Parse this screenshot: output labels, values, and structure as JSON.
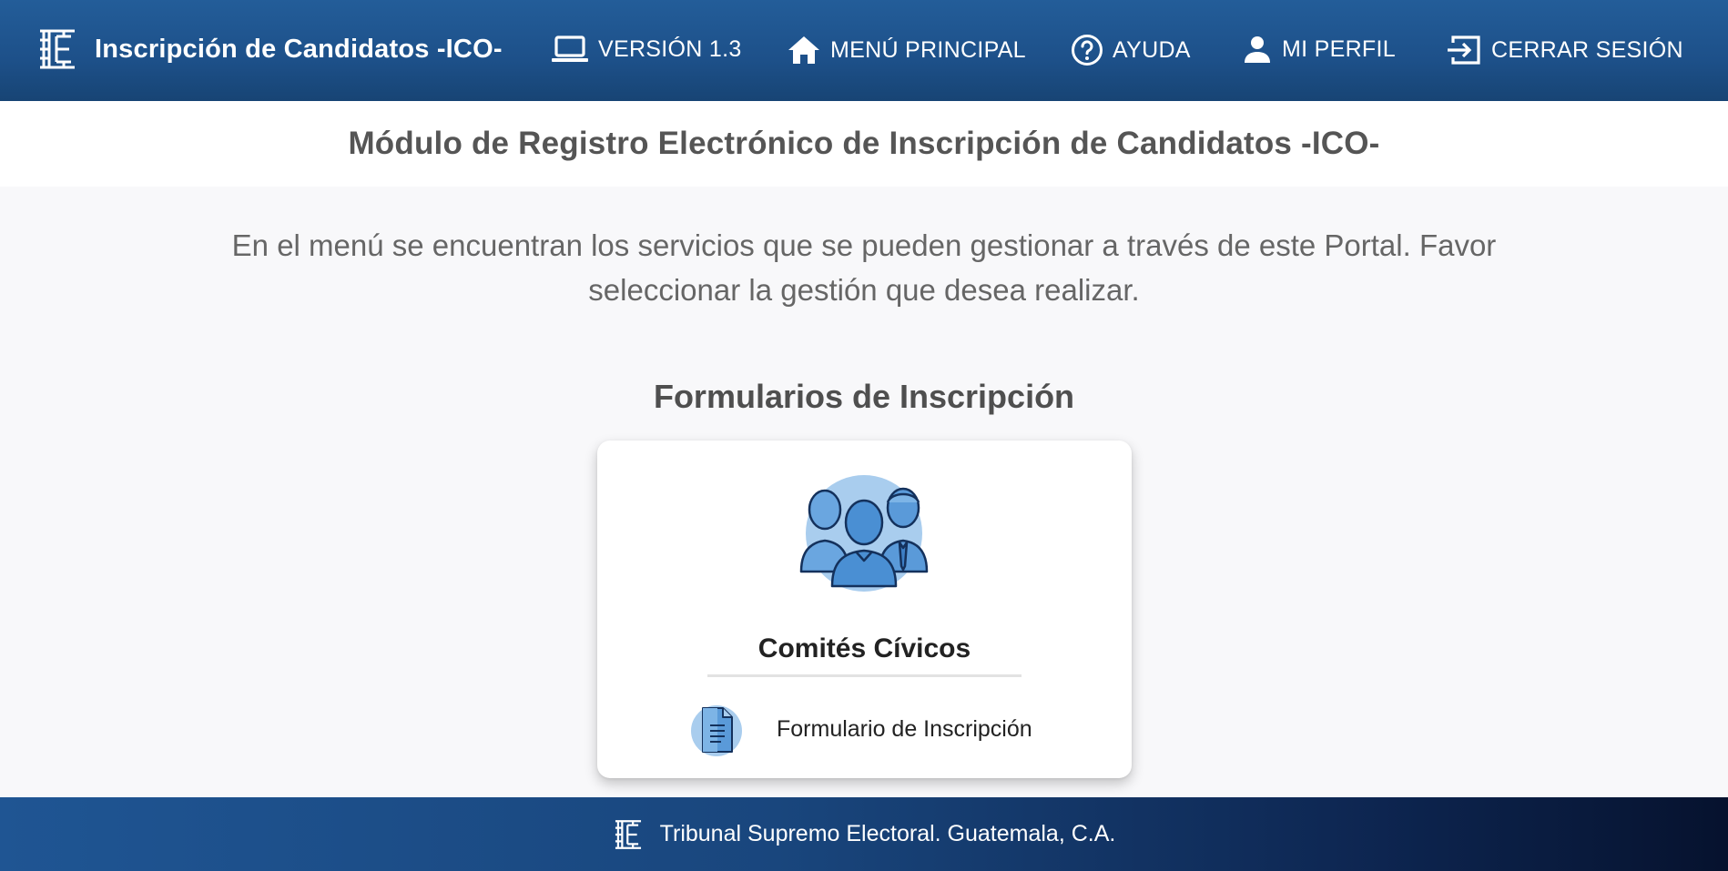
{
  "header": {
    "app_title": "Inscripción de Candidatos -ICO-",
    "logo_icon": "tse-logo-icon",
    "nav": [
      {
        "label": "VERSIÓN 1.3",
        "icon": "laptop-icon"
      },
      {
        "label": "MENÚ PRINCIPAL",
        "icon": "home-icon"
      },
      {
        "label": "AYUDA",
        "icon": "help-circle-icon"
      },
      {
        "label": "MI PERFIL",
        "icon": "person-icon"
      },
      {
        "label": "CERRAR SESIÓN",
        "icon": "logout-icon"
      }
    ]
  },
  "page": {
    "title": "Módulo de Registro Electrónico de Inscripción de Candidatos -ICO-",
    "intro": "En el menú se encuentran los servicios que se pueden gestionar a través de este Portal. Favor seleccionar la gestión que desea realizar.",
    "section_title": "Formularios de Inscripción"
  },
  "card": {
    "icon": "group-people-icon",
    "title": "Comités Cívicos",
    "links": [
      {
        "label": "Formulario de Inscripción",
        "icon": "document-icon"
      }
    ]
  },
  "footer": {
    "text": "Tribunal Supremo Electoral. Guatemala, C.A.",
    "logo_icon": "tse-logo-icon"
  },
  "colors": {
    "header_bg": "#1d5089",
    "footer_bg_end": "#06122e",
    "page_bg": "#f8f8fa",
    "icon_light_blue": "#a9cdee",
    "icon_mid_blue": "#5a9ad9",
    "icon_outline": "#14315c"
  }
}
